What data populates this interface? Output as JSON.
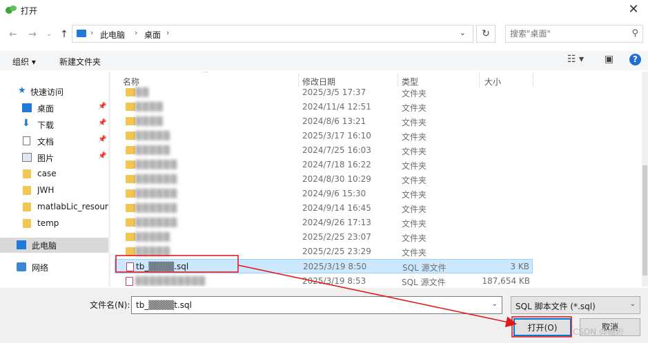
{
  "window": {
    "title": "打开",
    "close_icon": "close-icon"
  },
  "nav": {
    "breadcrumbs": [
      "此电脑",
      "桌面"
    ],
    "search_placeholder": "搜索\"桌面\""
  },
  "toolbar": {
    "organize": "组织 ▾",
    "new_folder": "新建文件夹"
  },
  "sidebar": {
    "quick_access": "快速访问",
    "items": [
      {
        "label": "桌面",
        "icon": "desktop-icon",
        "pinned": true
      },
      {
        "label": "下载",
        "icon": "download-icon",
        "pinned": true
      },
      {
        "label": "文档",
        "icon": "document-icon",
        "pinned": true
      },
      {
        "label": "图片",
        "icon": "picture-icon",
        "pinned": true
      },
      {
        "label": "case",
        "icon": "folder-icon",
        "pinned": false
      },
      {
        "label": "JWH",
        "icon": "folder-icon",
        "pinned": false
      },
      {
        "label": "matlabLic_resourc",
        "icon": "folder-icon",
        "pinned": false
      },
      {
        "label": "temp",
        "icon": "folder-icon",
        "pinned": false
      }
    ],
    "this_pc": "此电脑",
    "network": "网络"
  },
  "file_list": {
    "columns": [
      "名称",
      "修改日期",
      "类型",
      "大小"
    ],
    "rows": [
      {
        "name": "▒▒",
        "date": "2025/3/5 17:37",
        "type": "文件夹",
        "size": ""
      },
      {
        "name": "▒▒▒▒",
        "date": "2024/11/4 12:51",
        "type": "文件夹",
        "size": ""
      },
      {
        "name": "▒▒▒▒",
        "date": "2024/8/6 13:21",
        "type": "文件夹",
        "size": ""
      },
      {
        "name": "▒▒▒▒▒",
        "date": "2025/3/17 16:10",
        "type": "文件夹",
        "size": ""
      },
      {
        "name": "▒▒▒▒▒",
        "date": "2024/7/25 16:03",
        "type": "文件夹",
        "size": ""
      },
      {
        "name": "▒▒▒▒▒▒",
        "date": "2024/7/18 16:22",
        "type": "文件夹",
        "size": ""
      },
      {
        "name": "▒▒▒▒▒▒",
        "date": "2024/8/30 10:29",
        "type": "文件夹",
        "size": ""
      },
      {
        "name": "▒▒▒▒▒▒",
        "date": "2024/9/6 15:30",
        "type": "文件夹",
        "size": ""
      },
      {
        "name": "▒▒▒▒▒▒",
        "date": "2024/9/14 16:45",
        "type": "文件夹",
        "size": ""
      },
      {
        "name": "▒▒▒▒▒▒",
        "date": "2024/9/26 17:13",
        "type": "文件夹",
        "size": ""
      },
      {
        "name": "▒▒▒▒▒",
        "date": "2025/2/25 23:07",
        "type": "文件夹",
        "size": ""
      },
      {
        "name": "▒▒▒▒▒",
        "date": "2025/2/25 23:29",
        "type": "文件夹",
        "size": ""
      },
      {
        "name": "tb_▒▒▒▒.sql",
        "date": "2025/3/19 8:50",
        "type": "SQL 源文件",
        "size": "3 KB",
        "selected": true
      },
      {
        "name": "▒▒▒▒▒▒▒▒▒▒",
        "date": "2025/3/19 8:53",
        "type": "SQL 源文件",
        "size": "187,654 KB"
      }
    ]
  },
  "footer": {
    "filename_label": "文件名(N):",
    "filename_value": "tb_▒▒▒▒t.sql",
    "filter_value": "SQL 脚本文件 (*.sql)",
    "open_label": "打开(O)",
    "cancel_label": "取消",
    "watermark": "CSDN @岫珩"
  },
  "colors": {
    "accent": "#0078d7",
    "annotation": "#e0191d",
    "folder": "#f3c653",
    "selection": "#cce8ff"
  }
}
